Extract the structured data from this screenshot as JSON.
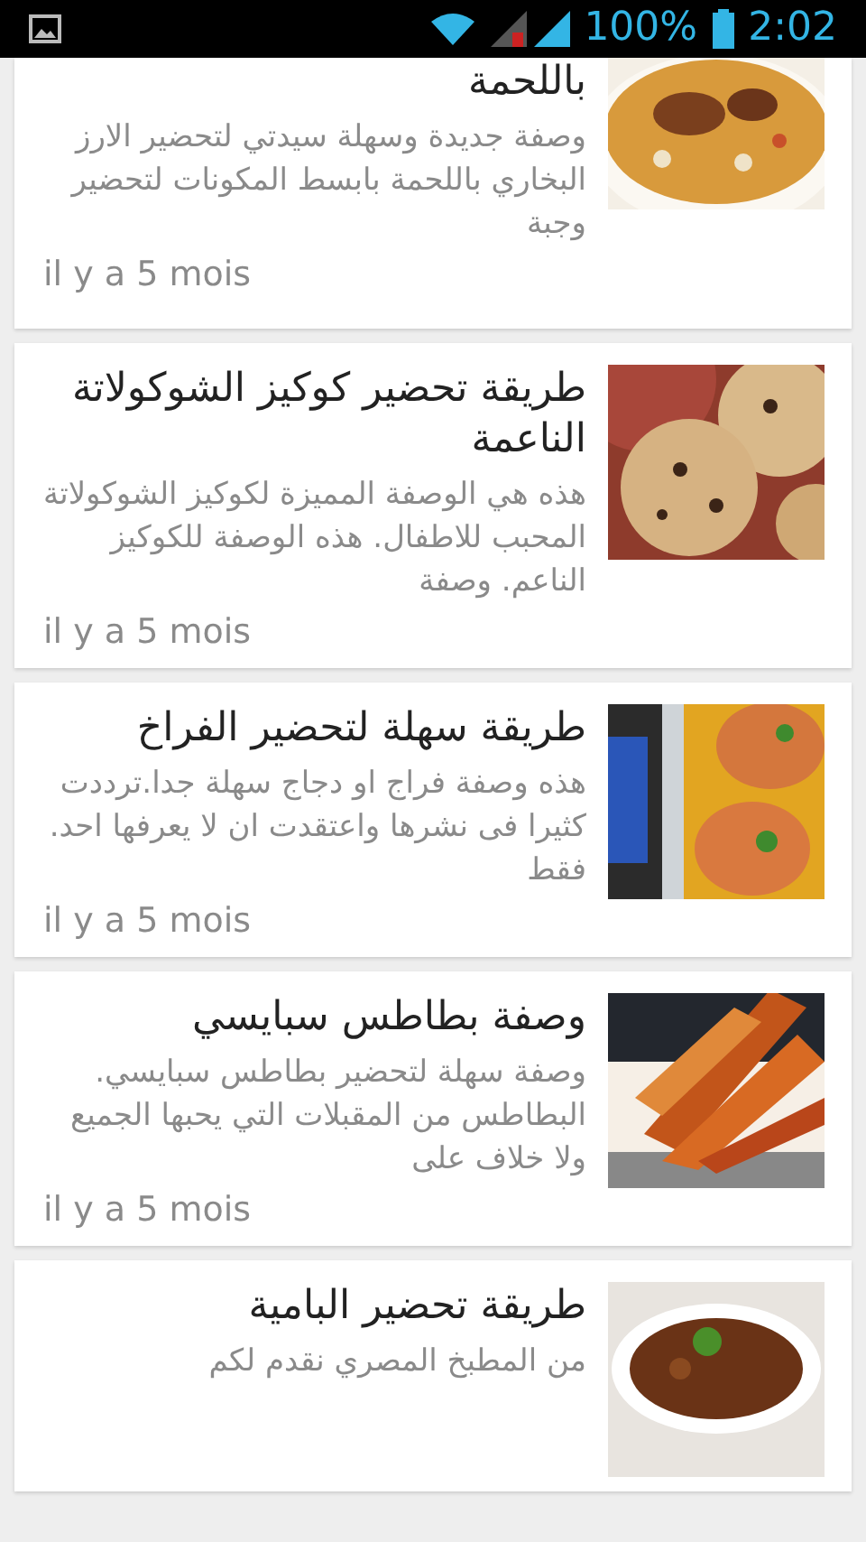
{
  "status_bar": {
    "battery": "100%",
    "time": "2:02"
  },
  "recipes": [
    {
      "title": "باللحمة",
      "description": "وصفة جديدة وسهلة سيدتي لتحضير الارز البخاري باللحمة بابسط المكونات لتحضير وجبة",
      "age": "il y a 5 mois"
    },
    {
      "title": "طريقة تحضير كوكيز الشوكولاتة الناعمة",
      "description": "هذه هي الوصفة المميزة لكوكيز الشوكولاتة المحبب للاطفال. هذه الوصفة للكوكيز الناعم. وصفة",
      "age": "il y a 5 mois"
    },
    {
      "title": "طريقة سهلة لتحضير الفراخ",
      "description": "هذه وصفة فراج او دجاج سهلة جدا.ترددت كثيرا فى نشرها واعتقدت ان لا يعرفها احد. فقط",
      "age": "il y a 5 mois"
    },
    {
      "title": "وصفة بطاطس سبايسي",
      "description": "وصفة سهلة لتحضير بطاطس سبايسي. البطاطس من المقبلات التي يحبها الجميع ولا خلاف على",
      "age": "il y a 5 mois"
    },
    {
      "title": "طريقة تحضير البامية",
      "description": "من المطبخ المصري نقدم لكم"
    }
  ]
}
